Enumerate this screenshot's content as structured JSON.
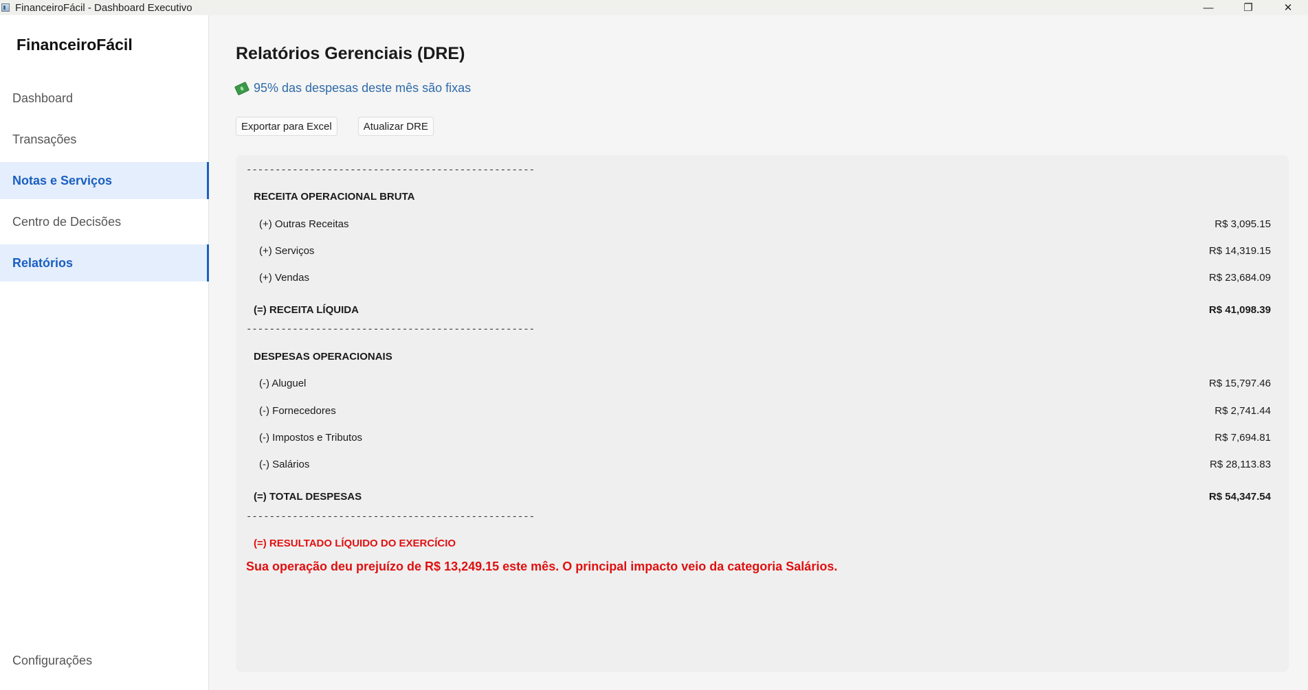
{
  "window": {
    "title": "FinanceiroFácil - Dashboard Executivo",
    "minimize": "—",
    "restore": "❐",
    "close": "✕"
  },
  "sidebar": {
    "brand": "FinanceiroFácil",
    "items": [
      {
        "label": "Dashboard"
      },
      {
        "label": "Transações"
      },
      {
        "label": "Notas e Serviços"
      },
      {
        "label": "Centro de Decisões"
      },
      {
        "label": "Relatórios"
      }
    ],
    "settings": "Configurações"
  },
  "main": {
    "title": "Relatórios Gerenciais (DRE)",
    "insight": "95% das despesas deste mês são fixas",
    "buttons": {
      "export": "Exportar para Excel",
      "refresh": "Atualizar DRE"
    }
  },
  "report": {
    "separator": "--------------------------------------------------",
    "revenue_header": "RECEITA OPERACIONAL BRUTA",
    "revenue_items": [
      {
        "label": "(+) Outras Receitas",
        "value": "R$ 3,095.15"
      },
      {
        "label": "(+) Serviços",
        "value": "R$ 14,319.15"
      },
      {
        "label": "(+) Vendas",
        "value": "R$ 23,684.09"
      }
    ],
    "net_revenue": {
      "label": "(=) RECEITA LÍQUIDA",
      "value": "R$ 41,098.39"
    },
    "expenses_header": "DESPESAS OPERACIONAIS",
    "expense_items": [
      {
        "label": "(-) Aluguel",
        "value": "R$ 15,797.46"
      },
      {
        "label": "(-) Fornecedores",
        "value": "R$ 2,741.44"
      },
      {
        "label": "(-) Impostos e Tributos",
        "value": "R$ 7,694.81"
      },
      {
        "label": "(-) Salários",
        "value": "R$ 28,113.83"
      }
    ],
    "total_expenses": {
      "label": "(=) TOTAL DESPESAS",
      "value": "R$ 54,347.54"
    },
    "result_label": "(=) RESULTADO LÍQUIDO DO EXERCÍCIO",
    "result_message": "Sua operação deu prejuízo de R$ 13,249.15 este mês. O principal impacto veio da categoria Salários.",
    "result_color": "#e01010"
  },
  "colors": {
    "accent": "#1a5fc0",
    "active_bg": "#e5eefc",
    "insight": "#2f6aa8"
  }
}
